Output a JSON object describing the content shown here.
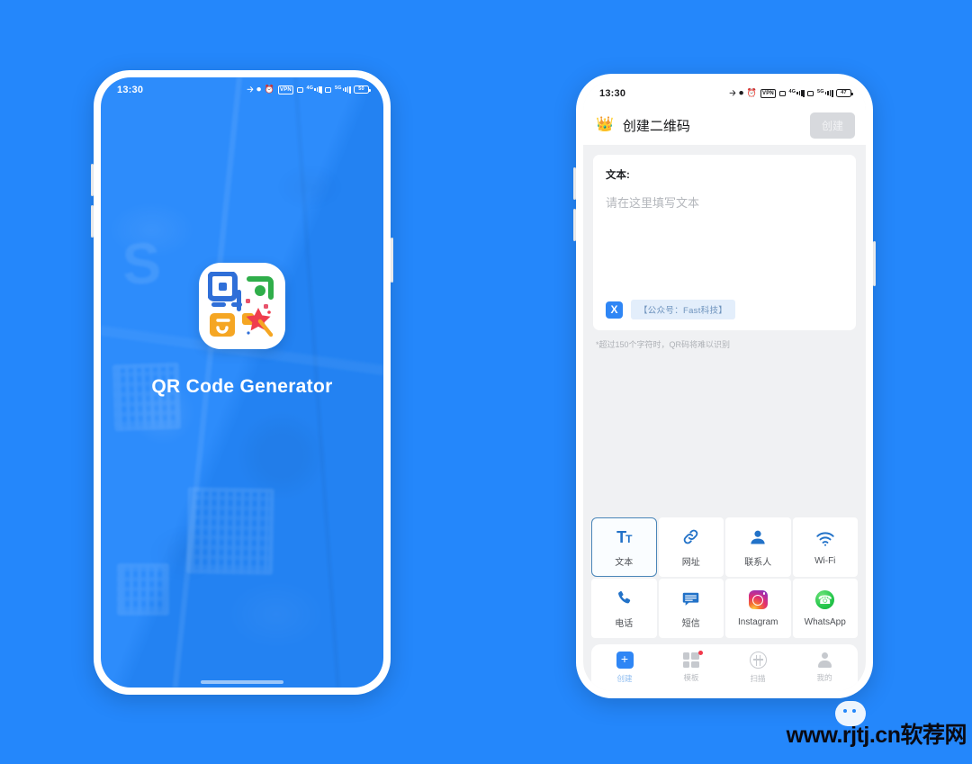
{
  "background_color": "#2487fb",
  "left_phone": {
    "status_bar": {
      "time": "13:30",
      "battery_text": "50",
      "net_labels": [
        "4G",
        "5G"
      ],
      "vpn_label": "VPN"
    },
    "splash": {
      "app_title": "QR Code Generator",
      "watermark_glyph": "S"
    }
  },
  "right_phone": {
    "status_bar": {
      "time": "13:30",
      "battery_text": "47",
      "net_labels": [
        "4G",
        "5G"
      ],
      "vpn_label": "VPN"
    },
    "header": {
      "crown_icon": "crown-icon",
      "title": "创建二维码",
      "create_label": "创建"
    },
    "form": {
      "field_label": "文本:",
      "placeholder": "请在这里填写文本",
      "tag_badge": "X",
      "tag_text": "【公众号：Fast科技】",
      "hint": "*超过150个字符时，QR码将难以识别"
    },
    "types": [
      {
        "id": "text",
        "label": "文本",
        "icon": "text-format-icon",
        "active": true
      },
      {
        "id": "url",
        "label": "网址",
        "icon": "link-icon",
        "active": false
      },
      {
        "id": "contact",
        "label": "联系人",
        "icon": "person-icon",
        "active": false
      },
      {
        "id": "wifi",
        "label": "Wi-Fi",
        "icon": "wifi-icon",
        "active": false
      },
      {
        "id": "phone",
        "label": "电话",
        "icon": "phone-icon",
        "active": false
      },
      {
        "id": "sms",
        "label": "短信",
        "icon": "message-icon",
        "active": false
      },
      {
        "id": "instagram",
        "label": "Instagram",
        "icon": "instagram-icon",
        "active": false
      },
      {
        "id": "whatsapp",
        "label": "WhatsApp",
        "icon": "whatsapp-icon",
        "active": false
      }
    ],
    "bottom_nav": [
      {
        "id": "create",
        "label": "创建",
        "icon": "plus-square-icon",
        "active": true,
        "badge": false
      },
      {
        "id": "template",
        "label": "模板",
        "icon": "grid-icon",
        "active": false,
        "badge": true
      },
      {
        "id": "scan",
        "label": "扫描",
        "icon": "scan-icon",
        "active": false,
        "badge": false
      },
      {
        "id": "mine",
        "label": "我的",
        "icon": "person-icon",
        "active": false,
        "badge": false
      }
    ]
  },
  "watermark": {
    "text": "www.rjtj.cn软荐网"
  }
}
